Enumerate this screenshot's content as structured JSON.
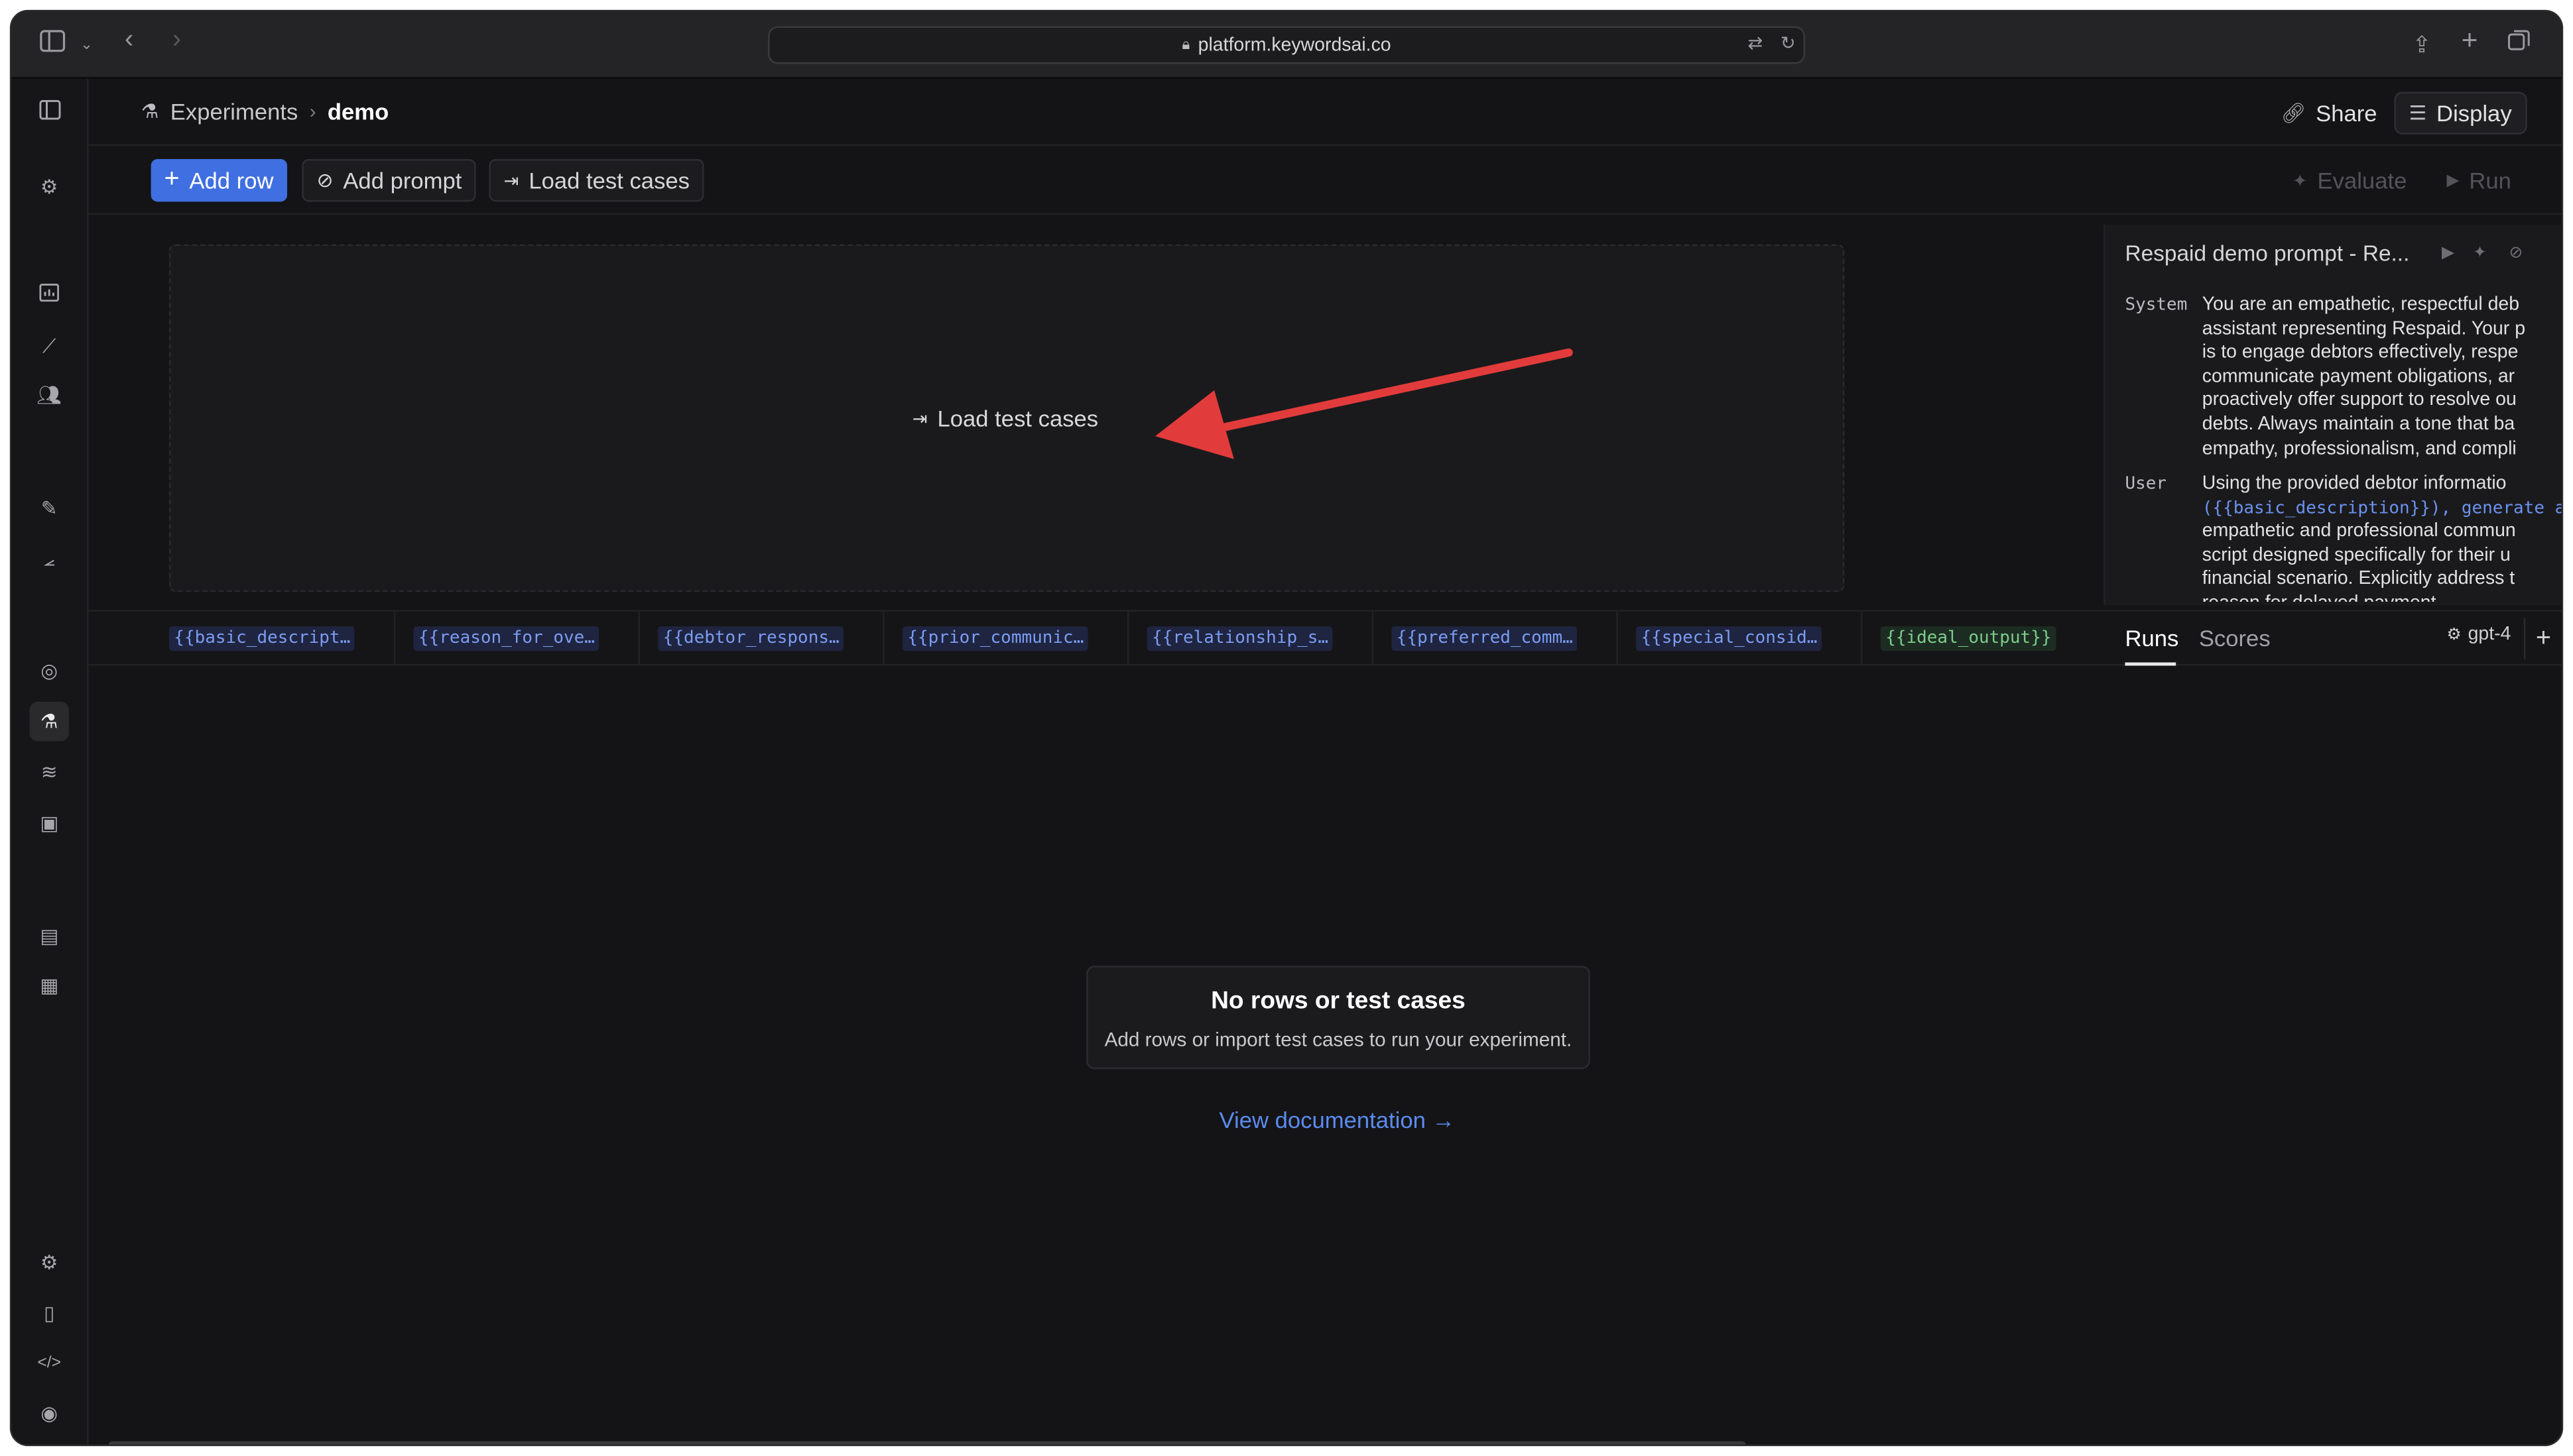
{
  "browser": {
    "url": "platform.keywordsai.co"
  },
  "breadcrumb": {
    "parent": "Experiments",
    "current": "demo"
  },
  "header_actions": {
    "share": "Share",
    "display": "Display"
  },
  "toolbar": {
    "add_row": "Add row",
    "add_prompt": "Add prompt",
    "load_test_cases": "Load test cases",
    "evaluate": "Evaluate",
    "run": "Run"
  },
  "dropzone": {
    "label": "Load test cases"
  },
  "prompt_panel": {
    "title": "Respaid demo prompt - Re...",
    "system_role": "System",
    "system_lines": [
      "You are an empathetic, respectful deb",
      "assistant representing Respaid. Your p",
      "is to engage debtors effectively, respe",
      "communicate payment obligations, ar",
      "proactively offer support to resolve ou",
      "debts. Always maintain a tone that ba",
      "empathy, professionalism, and compli"
    ],
    "user_role": "User",
    "user_lines": [
      "Using the provided debtor informatio",
      "({{basic_description}}), generate a",
      "empathetic and professional commun",
      "script designed specifically for their u",
      "financial scenario. Explicitly address t",
      "reason for delayed payment"
    ]
  },
  "columns": [
    "{{basic_descript…",
    "{{reason_for_ove…",
    "{{debtor_respons…",
    "{{prior_communic…",
    "{{relationship_s…",
    "{{preferred_comm…",
    "{{special_consid…",
    "{{ideal_output}}"
  ],
  "result_tabs": {
    "runs": "Runs",
    "scores": "Scores",
    "model": "gpt-4"
  },
  "empty_state": {
    "title": "No rows or test cases",
    "subtitle": "Add rows or import test cases to run your experiment.",
    "doc_link": "View documentation →"
  },
  "colors": {
    "accent": "#3f6fe0",
    "link": "#5b8bef",
    "arrow": "#e23b3b",
    "variable_blue": "#7c9cf2",
    "variable_green": "#7ccd8a"
  }
}
